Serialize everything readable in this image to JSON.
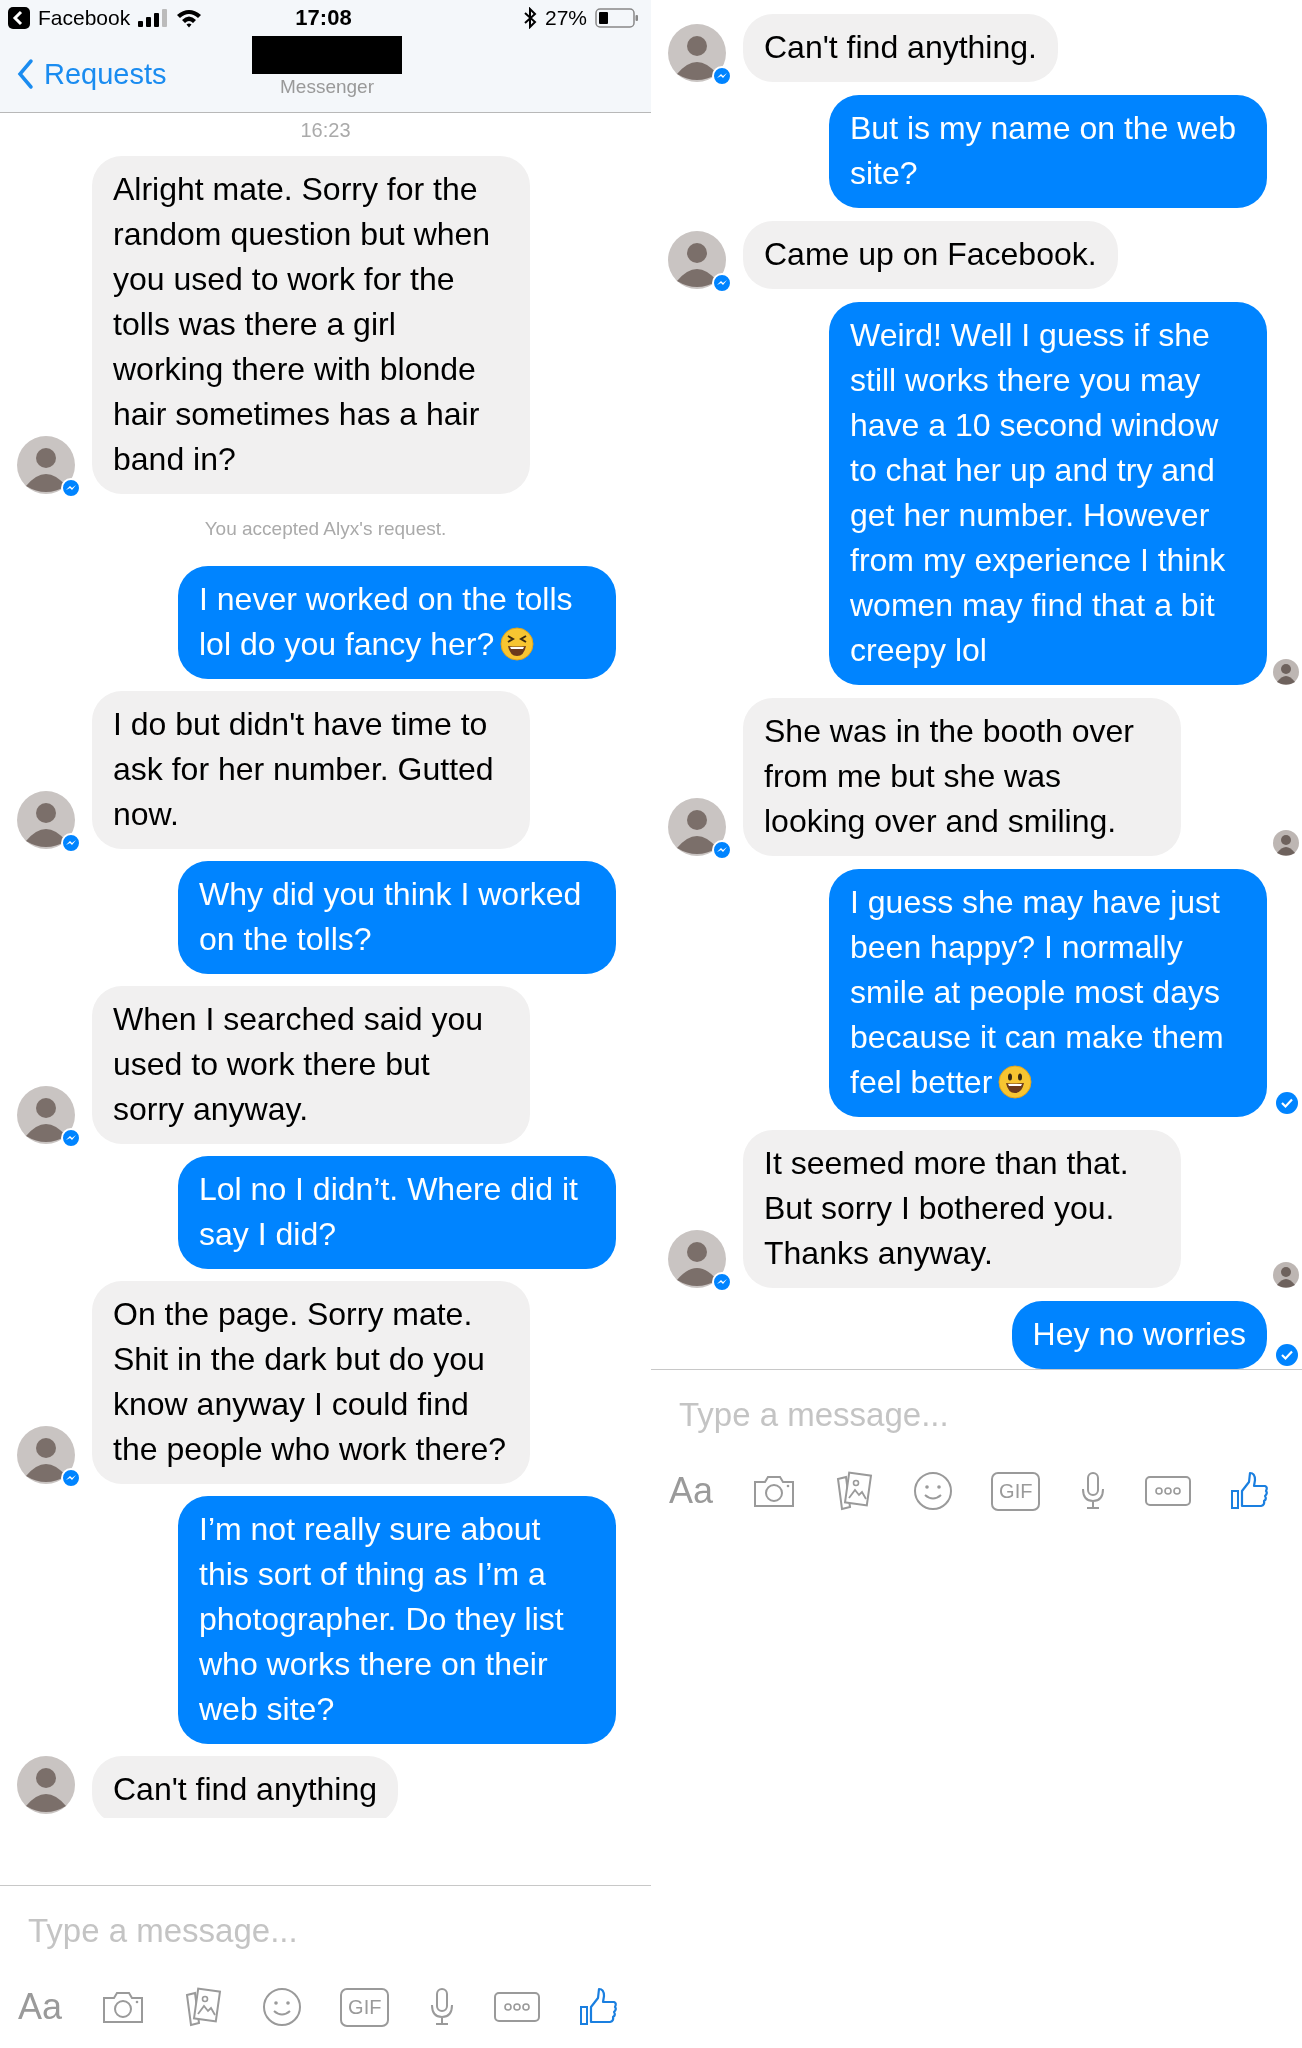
{
  "panels": [
    {
      "status_bar": {
        "back_app": "Facebook",
        "time": "17:08",
        "battery": "27%"
      },
      "nav": {
        "back": "Requests",
        "subtitle": "Messenger"
      },
      "messages": [
        {
          "kind": "time",
          "text": "16:23"
        },
        {
          "kind": "in",
          "text": "Alright mate. Sorry for the random question but when you used to work for the tolls was there a girl working there with blonde hair sometimes has a hair band in?"
        },
        {
          "kind": "system",
          "text": "You accepted Alyx's request."
        },
        {
          "kind": "out",
          "text": "I never worked on the tolls lol do you fancy her?",
          "emoji": {
            "kind": "laughing"
          }
        },
        {
          "kind": "in",
          "text": "I do but didn't have time to ask for her number. Gutted now."
        },
        {
          "kind": "out",
          "text": "Why did you think I worked on the tolls?"
        },
        {
          "kind": "in",
          "text": "When I searched said you used to work there but sorry anyway."
        },
        {
          "kind": "out",
          "text": "Lol no I didn’t. Where did it say I did?"
        },
        {
          "kind": "in",
          "text": "On the page. Sorry mate. Shit in the dark but do you know anyway I could find the people who work there?"
        },
        {
          "kind": "out",
          "text": "I’m not really sure about this sort of thing as I’m a photographer. Do they list who works there on their web site?"
        },
        {
          "kind": "in",
          "text": "Can't find anything",
          "clipped": true
        }
      ],
      "composer": {
        "placeholder": "Type a message...",
        "tools": [
          {
            "kind": "text",
            "label": "Aa"
          },
          {
            "kind": "camera"
          },
          {
            "kind": "gallery"
          },
          {
            "kind": "emoji"
          },
          {
            "kind": "boxed",
            "label": "GIF"
          },
          {
            "kind": "mic"
          },
          {
            "kind": "more"
          },
          {
            "kind": "like"
          }
        ]
      }
    },
    {
      "messages": [
        {
          "kind": "in",
          "text": "Can't find anything."
        },
        {
          "kind": "out",
          "text": "But is my name on the web site?"
        },
        {
          "kind": "in",
          "text": "Came up on Facebook."
        },
        {
          "kind": "out",
          "text": "Weird! Well I guess if she still works there you may have a 10 second window to chat her up and try and get her number. However from my experience I think women may find that a bit creepy lol",
          "receipt": {
            "kind": "seen"
          }
        },
        {
          "kind": "in",
          "text": "She was in the booth over from me but she was looking over and smiling.",
          "receipt": {
            "kind": "seen"
          }
        },
        {
          "kind": "out",
          "text": "I guess she may have just been happy? I normally smile at people most days because it can make them feel better",
          "emoji": {
            "kind": "smiley"
          },
          "receipt": {
            "kind": "delivered"
          }
        },
        {
          "kind": "in",
          "text": "It seemed more than that. But sorry I bothered you. Thanks anyway.",
          "receipt": {
            "kind": "seen"
          }
        },
        {
          "kind": "out",
          "text": "Hey no worries",
          "receipt": {
            "kind": "delivered"
          }
        }
      ],
      "composer": {
        "placeholder": "Type a message...",
        "tools": [
          {
            "kind": "text",
            "label": "Aa"
          },
          {
            "kind": "camera"
          },
          {
            "kind": "gallery"
          },
          {
            "kind": "emoji"
          },
          {
            "kind": "boxed",
            "label": "GIF"
          },
          {
            "kind": "mic"
          },
          {
            "kind": "more"
          },
          {
            "kind": "like"
          }
        ]
      }
    }
  ]
}
